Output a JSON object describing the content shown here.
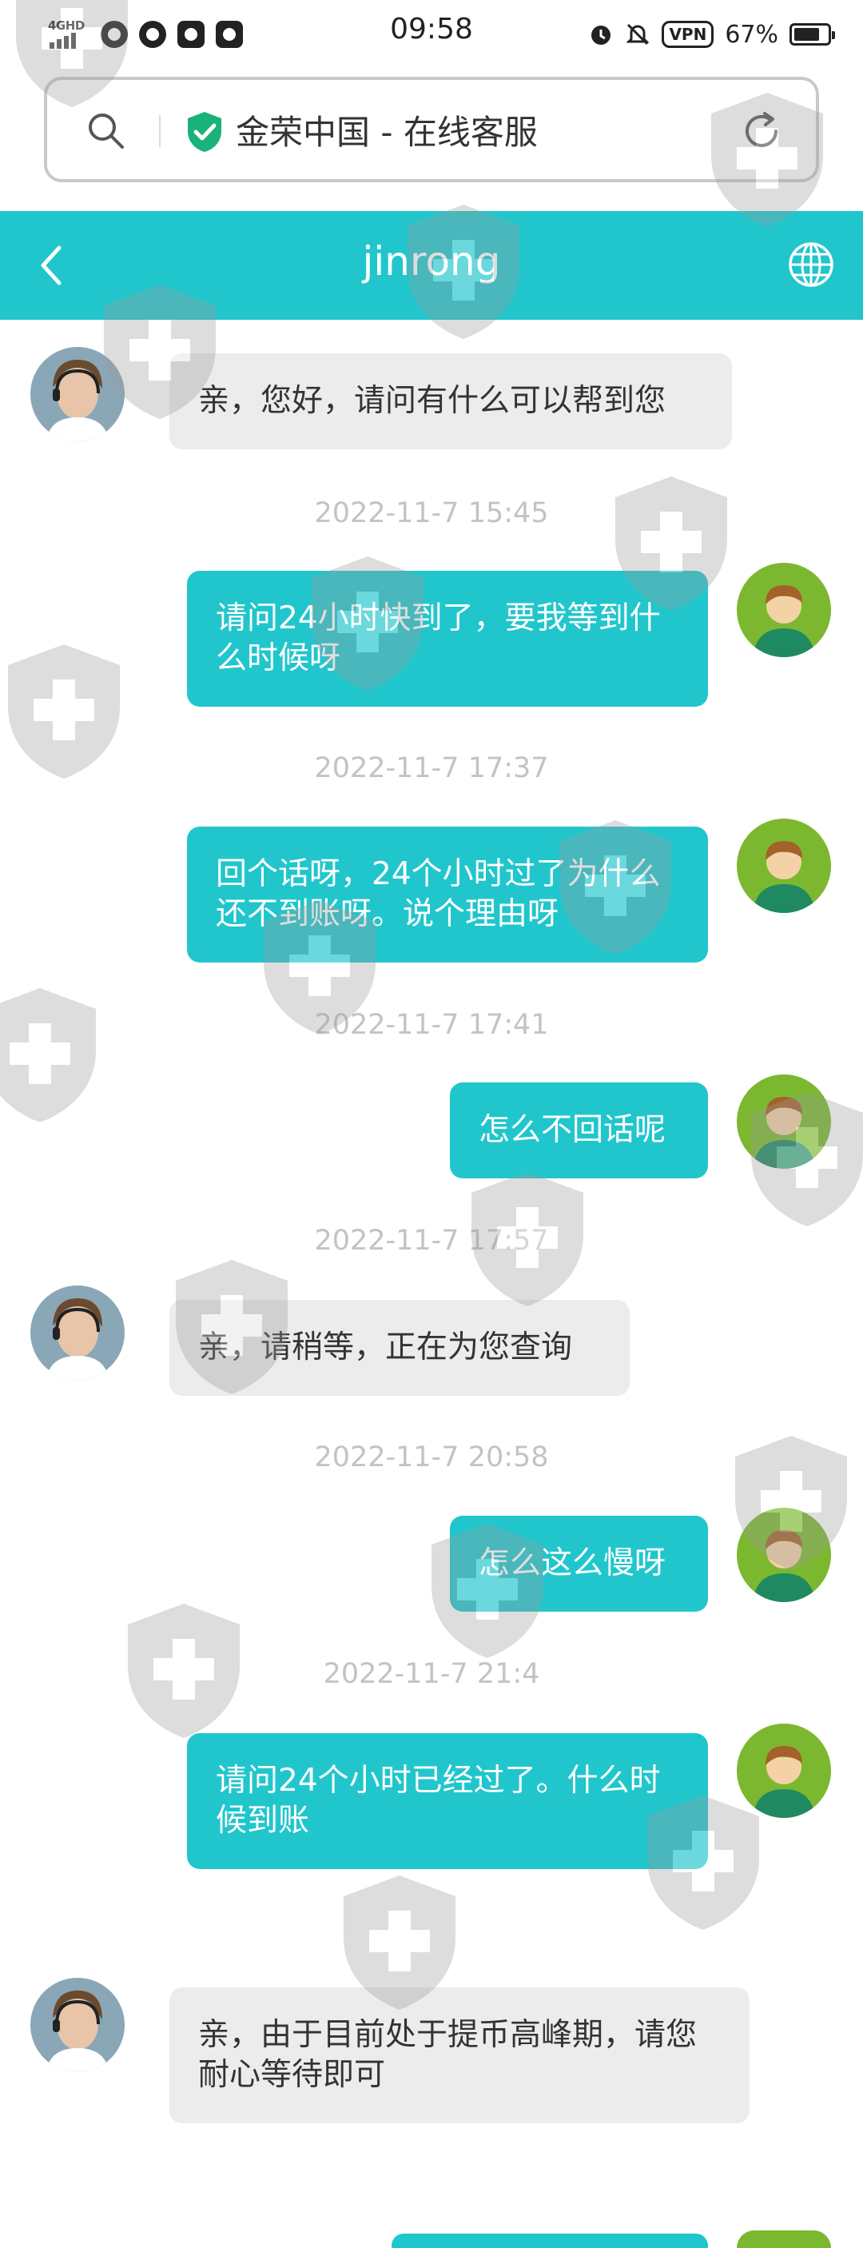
{
  "status_bar": {
    "network": "4GHD",
    "time": "09:58",
    "vpn": "VPN",
    "battery": "67%",
    "battery_level": 0.67,
    "icons": [
      "chat-app-icon",
      "wechat-icon",
      "tiktok-icon",
      "play-icon",
      "alarm-icon",
      "mute-icon"
    ]
  },
  "browser": {
    "title": "金荣中国 - 在线客服",
    "secure_color": "#19b27b"
  },
  "header": {
    "title": "jinrong",
    "color": "#21c6cc"
  },
  "messages": [
    {
      "side": "agent",
      "text": "亲，您好，请问有什么可以帮到您"
    },
    {
      "timestamp": "2022-11-7 15:45"
    },
    {
      "side": "user",
      "text": "请问24小时快到了，要我等到什么时候呀"
    },
    {
      "timestamp": "2022-11-7 17:37"
    },
    {
      "side": "user",
      "text": "回个话呀，24个小时过了为什么还不到账呀。说个理由呀"
    },
    {
      "timestamp": "2022-11-7 17:41"
    },
    {
      "side": "user",
      "text": "怎么不回话呢"
    },
    {
      "timestamp": "2022-11-7 17:57"
    },
    {
      "side": "agent",
      "text": "亲，请稍等，正在为您查询"
    },
    {
      "timestamp": "2022-11-7 20:58"
    },
    {
      "side": "user",
      "text": "怎么这么慢呀"
    },
    {
      "timestamp": "2022-11-7 21:4"
    },
    {
      "side": "user",
      "text": "请问24个小时已经过了。什么时候到账"
    },
    {
      "side": "agent",
      "text": "亲，由于目前处于提币高峰期，请您耐心等待即可"
    }
  ],
  "colors": {
    "outgoing_bubble": "#21c6cc",
    "incoming_bubble": "#ececec",
    "user_avatar_bg": "#7cb82f"
  }
}
